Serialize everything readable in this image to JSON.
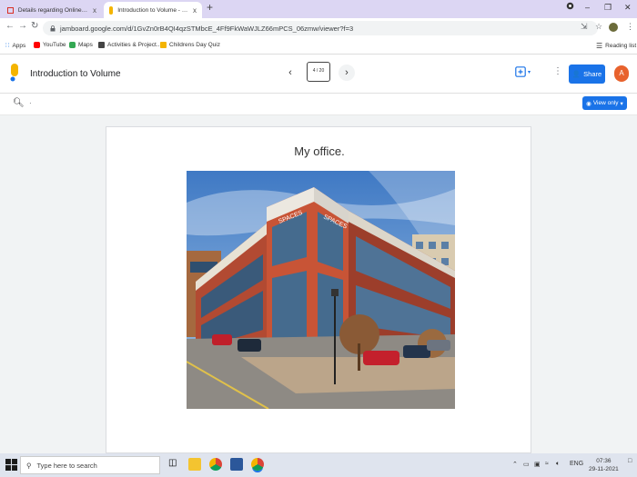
{
  "browser": {
    "tabs": [
      {
        "label": "Details regarding Online Session",
        "close": "x"
      },
      {
        "label": "Introduction to Volume - Google",
        "close": "x"
      }
    ],
    "new_tab": "+",
    "url": "jamboard.google.com/d/1GvZn0rB4QI4qzSTMbcE_4Ff9FkWaWJLZ66mPCS_06zmw/viewer?f=3",
    "bookmarks": [
      "Apps",
      "YouTube",
      "Maps",
      "Activities & Project...",
      "Childrens Day Quiz"
    ],
    "reading_list": "Reading list"
  },
  "app": {
    "title": "Introduction to Volume",
    "frame_indicator": "4 / 20",
    "share_label": "Share",
    "avatar_initial": "A",
    "view_only_label": "View only"
  },
  "frame": {
    "title": "My office."
  },
  "taskbar": {
    "search_placeholder": "Type here to search",
    "language": "ENG",
    "time": "07:36",
    "date": "29-11-2021"
  },
  "colors": {
    "accent": "#1a73e8",
    "tabstrip": "#dcd6f3",
    "avatar": "#e8622d",
    "jamboard_logo": "#f4b400"
  }
}
